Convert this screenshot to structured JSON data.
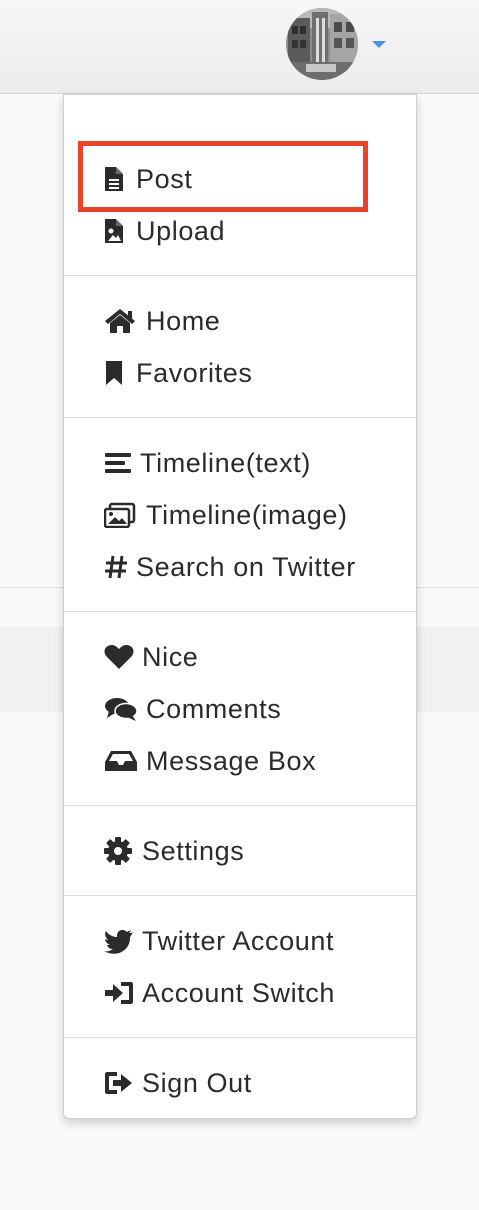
{
  "user_menu": {
    "sections": [
      [
        {
          "label": "Post",
          "icon": "file-text-icon"
        },
        {
          "label": "Upload",
          "icon": "file-image-icon"
        }
      ],
      [
        {
          "label": "Home",
          "icon": "home-icon"
        },
        {
          "label": "Favorites",
          "icon": "bookmark-icon"
        }
      ],
      [
        {
          "label": "Timeline(text)",
          "icon": "align-left-icon"
        },
        {
          "label": "Timeline(image)",
          "icon": "images-icon"
        },
        {
          "label": "Search on Twitter",
          "icon": "hashtag-icon"
        }
      ],
      [
        {
          "label": "Nice",
          "icon": "heart-icon"
        },
        {
          "label": "Comments",
          "icon": "comments-icon"
        },
        {
          "label": "Message Box",
          "icon": "inbox-icon"
        }
      ],
      [
        {
          "label": "Settings",
          "icon": "gear-icon"
        }
      ],
      [
        {
          "label": "Twitter Account",
          "icon": "twitter-icon"
        },
        {
          "label": "Account Switch",
          "icon": "sign-in-icon"
        }
      ],
      [
        {
          "label": "Sign Out",
          "icon": "sign-out-icon"
        }
      ]
    ]
  },
  "colors": {
    "highlight": "#e8432a",
    "caret": "#4a90e2",
    "text": "#2b2b2b"
  }
}
